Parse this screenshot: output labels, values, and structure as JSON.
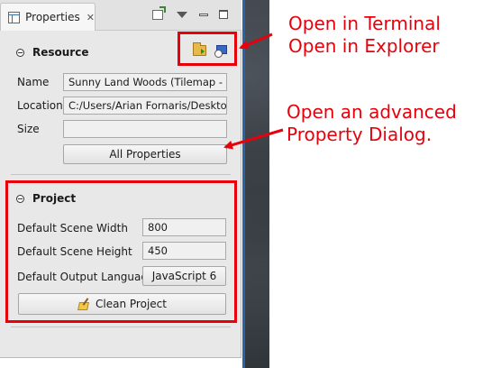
{
  "tab": {
    "title": "Properties",
    "close_symbol": "✕"
  },
  "resource": {
    "heading": "Resource",
    "name_label": "Name",
    "name_value": "Sunny Land Woods (Tilemap - Fa",
    "location_label": "Location",
    "location_value": "C:/Users/Arian Fornaris/Desktop/",
    "size_label": "Size",
    "size_value": "",
    "all_properties_label": "All Properties",
    "actions": [
      "open-in-terminal-icon",
      "open-in-explorer-icon"
    ]
  },
  "project": {
    "heading": "Project",
    "width_label": "Default Scene Width",
    "width_value": "800",
    "height_label": "Default Scene Height",
    "height_value": "450",
    "language_label": "Default Output Language",
    "language_value": "JavaScript 6",
    "clean_label": "Clean Project"
  },
  "annotations": {
    "terminal_note": "Open in Terminal",
    "explorer_note": "Open in Explorer",
    "dialog_note_line1": "Open an advanced",
    "dialog_note_line2": "Property Dialog.",
    "color": "#e8000b"
  },
  "colors": {
    "view_bg": "#e8e8e8",
    "field_bg": "#f0f0f0",
    "accent": "#e8000b"
  }
}
